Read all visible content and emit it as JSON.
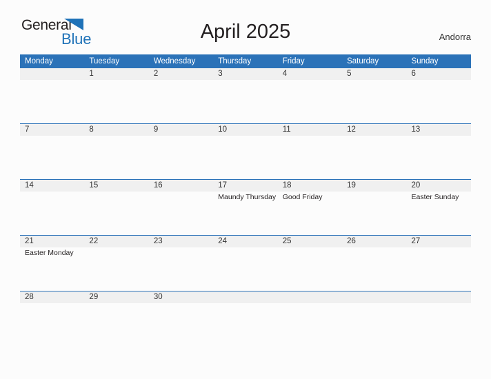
{
  "brand": {
    "name_part1": "General",
    "name_part2": "Blue",
    "flag_icon": "blue-triangle-flag-icon",
    "accent_color": "#1f72b8"
  },
  "header": {
    "title": "April 2025",
    "country": "Andorra"
  },
  "calendar": {
    "header_color": "#2b72b8",
    "daynum_band_color": "#f0f0f0",
    "weekday_headers": [
      "Monday",
      "Tuesday",
      "Wednesday",
      "Thursday",
      "Friday",
      "Saturday",
      "Sunday"
    ],
    "weeks": [
      [
        {
          "day": "",
          "events": []
        },
        {
          "day": "1",
          "events": []
        },
        {
          "day": "2",
          "events": []
        },
        {
          "day": "3",
          "events": []
        },
        {
          "day": "4",
          "events": []
        },
        {
          "day": "5",
          "events": []
        },
        {
          "day": "6",
          "events": []
        }
      ],
      [
        {
          "day": "7",
          "events": []
        },
        {
          "day": "8",
          "events": []
        },
        {
          "day": "9",
          "events": []
        },
        {
          "day": "10",
          "events": []
        },
        {
          "day": "11",
          "events": []
        },
        {
          "day": "12",
          "events": []
        },
        {
          "day": "13",
          "events": []
        }
      ],
      [
        {
          "day": "14",
          "events": []
        },
        {
          "day": "15",
          "events": []
        },
        {
          "day": "16",
          "events": []
        },
        {
          "day": "17",
          "events": [
            "Maundy Thursday"
          ]
        },
        {
          "day": "18",
          "events": [
            "Good Friday"
          ]
        },
        {
          "day": "19",
          "events": []
        },
        {
          "day": "20",
          "events": [
            "Easter Sunday"
          ]
        }
      ],
      [
        {
          "day": "21",
          "events": [
            "Easter Monday"
          ]
        },
        {
          "day": "22",
          "events": []
        },
        {
          "day": "23",
          "events": []
        },
        {
          "day": "24",
          "events": []
        },
        {
          "day": "25",
          "events": []
        },
        {
          "day": "26",
          "events": []
        },
        {
          "day": "27",
          "events": []
        }
      ],
      [
        {
          "day": "28",
          "events": []
        },
        {
          "day": "29",
          "events": []
        },
        {
          "day": "30",
          "events": []
        },
        {
          "day": "",
          "events": []
        },
        {
          "day": "",
          "events": []
        },
        {
          "day": "",
          "events": []
        },
        {
          "day": "",
          "events": []
        }
      ]
    ]
  }
}
